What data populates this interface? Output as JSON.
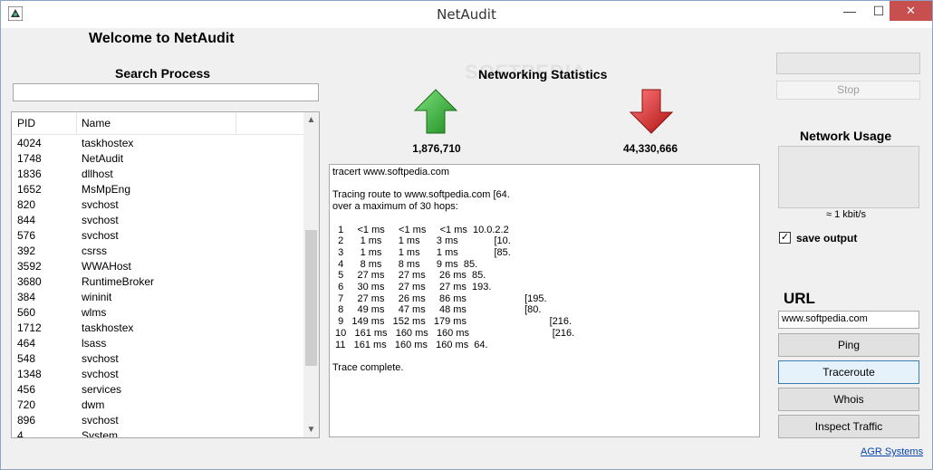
{
  "window": {
    "title": "NetAudit",
    "min_symbol": "—",
    "max_symbol": "☐",
    "close_symbol": "✕"
  },
  "welcome": "Welcome to NetAudit",
  "search": {
    "label": "Search Process",
    "value": ""
  },
  "process_list": {
    "columns": [
      "PID",
      "Name"
    ],
    "rows": [
      {
        "pid": "4024",
        "name": "taskhostex"
      },
      {
        "pid": "1748",
        "name": "NetAudit"
      },
      {
        "pid": "1836",
        "name": "dllhost"
      },
      {
        "pid": "1652",
        "name": "MsMpEng"
      },
      {
        "pid": "820",
        "name": "svchost"
      },
      {
        "pid": "844",
        "name": "svchost"
      },
      {
        "pid": "576",
        "name": "svchost"
      },
      {
        "pid": "392",
        "name": "csrss"
      },
      {
        "pid": "3592",
        "name": "WWAHost"
      },
      {
        "pid": "3680",
        "name": "RuntimeBroker"
      },
      {
        "pid": "384",
        "name": "wininit"
      },
      {
        "pid": "560",
        "name": "wlms"
      },
      {
        "pid": "1712",
        "name": "taskhostex"
      },
      {
        "pid": "464",
        "name": "lsass"
      },
      {
        "pid": "548",
        "name": "svchost"
      },
      {
        "pid": "1348",
        "name": "svchost"
      },
      {
        "pid": "456",
        "name": "services"
      },
      {
        "pid": "720",
        "name": "dwm"
      },
      {
        "pid": "896",
        "name": "svchost"
      },
      {
        "pid": "4",
        "name": "System"
      }
    ]
  },
  "stats": {
    "label": "Networking Statistics",
    "upload": "1,876,710",
    "download": "44,330,666"
  },
  "console_text": "tracert www.softpedia.com\n\nTracing route to www.softpedia.com [64.\nover a maximum of 30 hops:\n\n  1     <1 ms     <1 ms     <1 ms  10.0.2.2\n  2      1 ms      1 ms      3 ms             [10.\n  3      1 ms      1 ms      1 ms             [85.\n  4      8 ms      8 ms      9 ms  85.\n  5     27 ms     27 ms     26 ms  85.\n  6     30 ms     27 ms     27 ms  193.\n  7     27 ms     26 ms     86 ms                     [195.\n  8     49 ms     47 ms     48 ms                     [80.\n  9   149 ms   152 ms   179 ms                              [216.\n 10   161 ms   160 ms   160 ms                              [216.\n 11   161 ms   160 ms   160 ms  64.\n\nTrace complete.",
  "right_panel": {
    "top_field_value": "",
    "stop_label": "Stop",
    "network_usage_label": "Network Usage",
    "usage_value": "≈ 1 kbit/s",
    "save_output_label": "save output",
    "save_output_checked": "✓",
    "url_label": "URL",
    "url_value": "www.softpedia.com",
    "buttons": [
      "Ping",
      "Traceroute",
      "Whois",
      "Inspect Traffic"
    ],
    "link": "AGR Systems"
  },
  "colors": {
    "upload_arrow": "#2e9b2e",
    "download_arrow": "#d22020"
  }
}
